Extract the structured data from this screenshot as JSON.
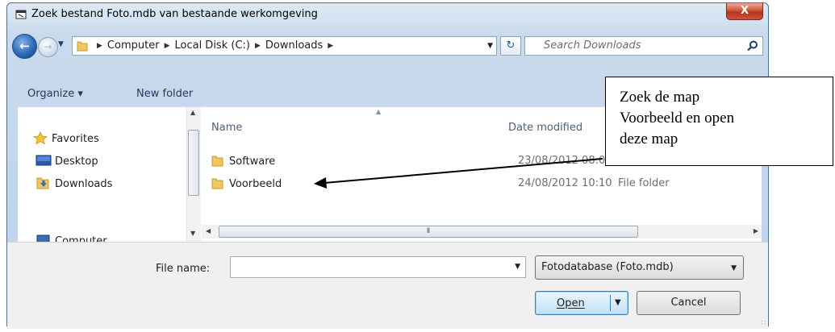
{
  "window": {
    "title": "Zoek bestand Foto.mdb van bestaande werkomgeving",
    "close_label": "X"
  },
  "navigation": {
    "breadcrumbs": [
      "Computer",
      "Local Disk (C:)",
      "Downloads"
    ],
    "search_placeholder": "Search Downloads"
  },
  "toolbar": {
    "organize_label": "Organize ▾",
    "new_folder_label": "New folder"
  },
  "sidebar": {
    "items": [
      {
        "label": "Favorites",
        "icon": "star-icon"
      },
      {
        "label": "Desktop",
        "icon": "desktop-icon"
      },
      {
        "label": "Downloads",
        "icon": "downloads-folder-icon"
      },
      {
        "label": "Computer",
        "icon": "computer-icon"
      }
    ]
  },
  "file_list": {
    "columns": [
      "Name",
      "Date modified"
    ],
    "rows": [
      {
        "name": "Software",
        "date": "23/08/2012 08:0",
        "type": ""
      },
      {
        "name": "Voorbeeld",
        "date": "24/08/2012 10:10",
        "type": "File folder"
      }
    ]
  },
  "footer": {
    "filename_label": "File name:",
    "filename_value": "",
    "filter_value": "Fotodatabase (Foto.mdb)",
    "open_label": "Open",
    "cancel_label": "Cancel"
  },
  "annotation": {
    "lines": [
      "Zoek de map",
      "Voorbeeld en open",
      "deze map"
    ]
  }
}
